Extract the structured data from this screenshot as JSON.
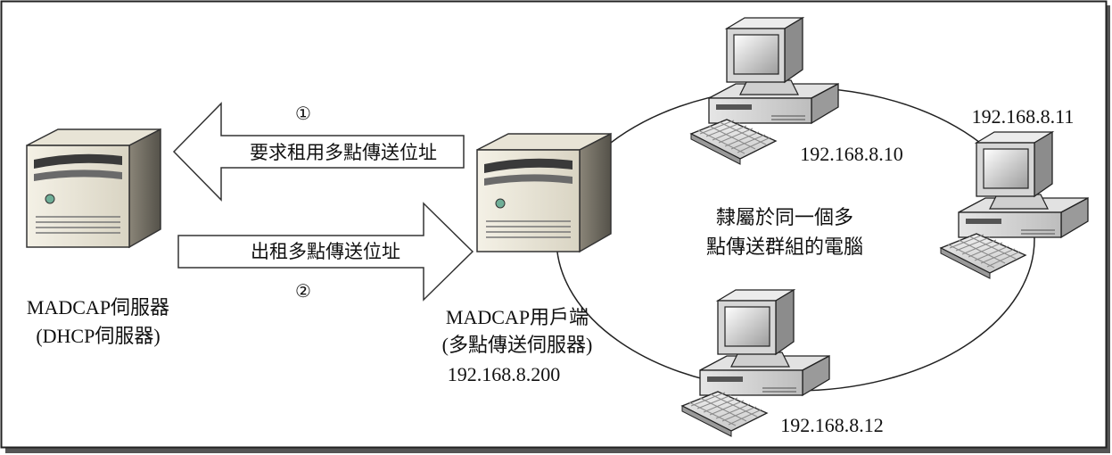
{
  "server": {
    "name_line1": "MADCAP伺服器",
    "name_line2": "(DHCP伺服器)"
  },
  "client": {
    "name_line1": "MADCAP用戶端",
    "name_line2": "(多點傳送伺服器)",
    "ip": "192.168.8.200"
  },
  "arrows": {
    "request": {
      "step": "①",
      "label": "要求租用多點傳送位址"
    },
    "lease": {
      "step": "②",
      "label": "出租多點傳送位址"
    }
  },
  "group": {
    "label_line1": "隸屬於同一個多",
    "label_line2": "點傳送群組的電腦"
  },
  "computers": [
    {
      "ip": "192.168.8.10"
    },
    {
      "ip": "192.168.8.11"
    },
    {
      "ip": "192.168.8.12"
    }
  ]
}
